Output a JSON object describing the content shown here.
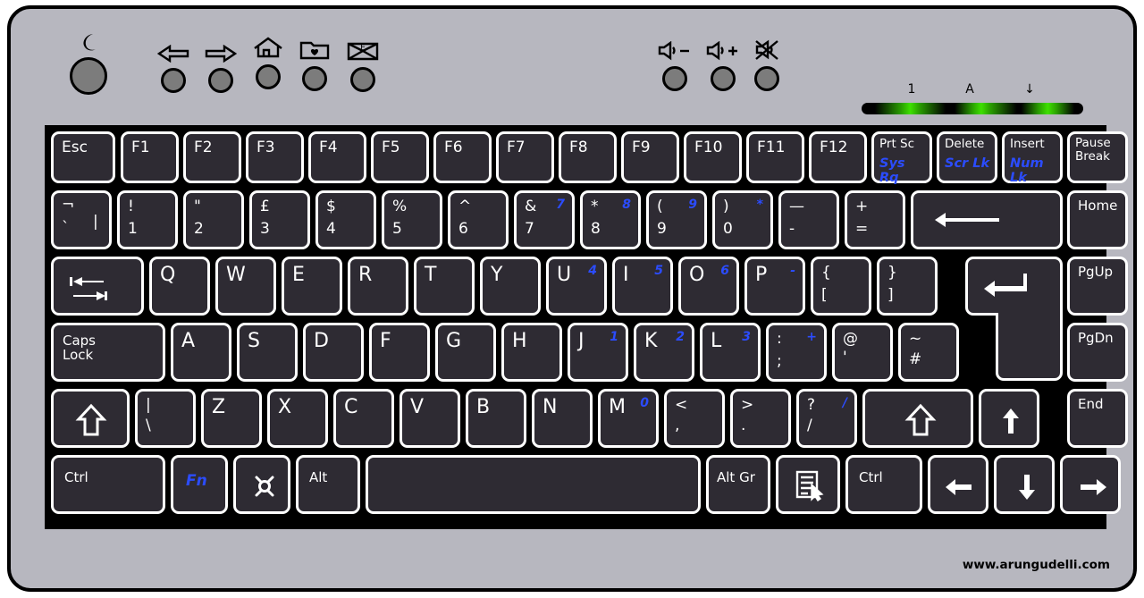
{
  "device": {
    "type": "laptop-keyboard-diagram",
    "layout": "UK English",
    "body_color": "#b7b7bf",
    "key_color": "#2e2b33",
    "legend_color": "#ffffff",
    "fn_legend_color": "#2b4cff",
    "led_color": "#3ee000"
  },
  "hotkeys": [
    {
      "name": "power-button",
      "icon": "moon-icon",
      "label": ""
    },
    {
      "name": "back-button",
      "icon": "arrow-left-icon",
      "label": ""
    },
    {
      "name": "forward-button",
      "icon": "arrow-right-icon",
      "label": ""
    },
    {
      "name": "home-button",
      "icon": "house-icon",
      "label": ""
    },
    {
      "name": "favorites-button",
      "icon": "folder-heart-icon",
      "label": ""
    },
    {
      "name": "email-button",
      "icon": "envelope-icon",
      "label": ""
    },
    {
      "name": "volume-down-button",
      "icon": "speaker-minus-icon",
      "label": ""
    },
    {
      "name": "volume-up-button",
      "icon": "speaker-plus-icon",
      "label": ""
    },
    {
      "name": "mute-button",
      "icon": "speaker-mute-icon",
      "label": ""
    }
  ],
  "leds": [
    {
      "name": "num-lock-led",
      "label": "1"
    },
    {
      "name": "caps-lock-led",
      "label": "A"
    },
    {
      "name": "scroll-lock-led",
      "label": "↓"
    }
  ],
  "rows": {
    "function_row": [
      {
        "name": "key-esc",
        "main": "Esc"
      },
      {
        "name": "key-f1",
        "main": "F1"
      },
      {
        "name": "key-f2",
        "main": "F2"
      },
      {
        "name": "key-f3",
        "main": "F3"
      },
      {
        "name": "key-f4",
        "main": "F4"
      },
      {
        "name": "key-f5",
        "main": "F5"
      },
      {
        "name": "key-f6",
        "main": "F6"
      },
      {
        "name": "key-f7",
        "main": "F7"
      },
      {
        "name": "key-f8",
        "main": "F8"
      },
      {
        "name": "key-f9",
        "main": "F9"
      },
      {
        "name": "key-f10",
        "main": "F10"
      },
      {
        "name": "key-f11",
        "main": "F11"
      },
      {
        "name": "key-f12",
        "main": "F12"
      },
      {
        "name": "key-print-screen",
        "main": "Prt Sc",
        "fn": "Sys Rq"
      },
      {
        "name": "key-delete",
        "main": "Delete",
        "fn": "Scr Lk"
      },
      {
        "name": "key-insert",
        "main": "Insert",
        "fn": "Num Lk"
      },
      {
        "name": "key-pause-break",
        "main": "Pause\nBreak"
      }
    ],
    "number_row": [
      {
        "name": "key-backtick",
        "shift": "¬",
        "base": "`",
        "extra": "|"
      },
      {
        "name": "key-1",
        "shift": "!",
        "base": "1"
      },
      {
        "name": "key-2",
        "shift": "\"",
        "base": "2"
      },
      {
        "name": "key-3",
        "shift": "£",
        "base": "3"
      },
      {
        "name": "key-4",
        "shift": "$",
        "base": "4"
      },
      {
        "name": "key-5",
        "shift": "%",
        "base": "5"
      },
      {
        "name": "key-6",
        "shift": "^",
        "base": "6"
      },
      {
        "name": "key-7",
        "shift": "&",
        "base": "7",
        "num": "7"
      },
      {
        "name": "key-8",
        "shift": "*",
        "base": "8",
        "num": "8"
      },
      {
        "name": "key-9",
        "shift": "(",
        "base": "9",
        "num": "9"
      },
      {
        "name": "key-0",
        "shift": ")",
        "base": "0",
        "num": "*"
      },
      {
        "name": "key-minus",
        "shift": "—",
        "base": "-"
      },
      {
        "name": "key-equals",
        "shift": "+",
        "base": "="
      },
      {
        "name": "key-backspace",
        "icon": "arrow-left-long-icon"
      },
      {
        "name": "key-home",
        "main": "Home"
      }
    ],
    "top_letter_row": [
      {
        "name": "key-tab",
        "icon": "tab-arrows-icon"
      },
      {
        "name": "key-q",
        "main": "Q"
      },
      {
        "name": "key-w",
        "main": "W"
      },
      {
        "name": "key-e",
        "main": "E"
      },
      {
        "name": "key-r",
        "main": "R"
      },
      {
        "name": "key-t",
        "main": "T"
      },
      {
        "name": "key-y",
        "main": "Y"
      },
      {
        "name": "key-u",
        "main": "U",
        "num": "4"
      },
      {
        "name": "key-i",
        "main": "I",
        "num": "5"
      },
      {
        "name": "key-o",
        "main": "O",
        "num": "6"
      },
      {
        "name": "key-p",
        "main": "P",
        "num": "-"
      },
      {
        "name": "key-bracket-left",
        "shift": "{",
        "base": "["
      },
      {
        "name": "key-bracket-right",
        "shift": "}",
        "base": "]"
      },
      {
        "name": "key-enter",
        "icon": "enter-arrow-icon"
      },
      {
        "name": "key-page-up",
        "main": "PgUp"
      }
    ],
    "home_row": [
      {
        "name": "key-caps-lock",
        "main": "Caps\nLock"
      },
      {
        "name": "key-a",
        "main": "A"
      },
      {
        "name": "key-s",
        "main": "S"
      },
      {
        "name": "key-d",
        "main": "D"
      },
      {
        "name": "key-f",
        "main": "F"
      },
      {
        "name": "key-g",
        "main": "G"
      },
      {
        "name": "key-h",
        "main": "H"
      },
      {
        "name": "key-j",
        "main": "J",
        "num": "1"
      },
      {
        "name": "key-k",
        "main": "K",
        "num": "2"
      },
      {
        "name": "key-l",
        "main": "L",
        "num": "3"
      },
      {
        "name": "key-semicolon",
        "shift": ":",
        "base": ";",
        "num": "+"
      },
      {
        "name": "key-apostrophe",
        "shift": "@",
        "base": "'"
      },
      {
        "name": "key-hash",
        "shift": "~",
        "base": "#"
      },
      {
        "name": "key-page-down",
        "main": "PgDn"
      }
    ],
    "bottom_letter_row": [
      {
        "name": "key-shift-left",
        "icon": "shift-arrow-icon"
      },
      {
        "name": "key-backslash",
        "shift": "|",
        "base": "\\"
      },
      {
        "name": "key-z",
        "main": "Z"
      },
      {
        "name": "key-x",
        "main": "X"
      },
      {
        "name": "key-c",
        "main": "C"
      },
      {
        "name": "key-v",
        "main": "V"
      },
      {
        "name": "key-b",
        "main": "B"
      },
      {
        "name": "key-n",
        "main": "N"
      },
      {
        "name": "key-m",
        "main": "M",
        "num": "0"
      },
      {
        "name": "key-comma",
        "shift": "<",
        "base": ","
      },
      {
        "name": "key-period",
        "shift": ">",
        "base": "."
      },
      {
        "name": "key-slash",
        "shift": "?",
        "base": "/",
        "num": "/"
      },
      {
        "name": "key-shift-right",
        "icon": "shift-arrow-icon"
      },
      {
        "name": "key-arrow-up",
        "icon": "arrow-up-icon"
      },
      {
        "name": "key-end",
        "main": "End"
      }
    ],
    "modifier_row": [
      {
        "name": "key-ctrl-left",
        "main": "Ctrl"
      },
      {
        "name": "key-fn",
        "fnonly": "Fn"
      },
      {
        "name": "key-super",
        "icon": "os-logo-icon"
      },
      {
        "name": "key-alt-left",
        "main": "Alt"
      },
      {
        "name": "key-space",
        "main": ""
      },
      {
        "name": "key-alt-gr",
        "main": "Alt Gr"
      },
      {
        "name": "key-menu",
        "icon": "context-menu-icon"
      },
      {
        "name": "key-ctrl-right",
        "main": "Ctrl"
      },
      {
        "name": "key-arrow-left",
        "icon": "arrow-left-icon"
      },
      {
        "name": "key-arrow-down",
        "icon": "arrow-down-icon"
      },
      {
        "name": "key-arrow-right",
        "icon": "arrow-right-icon"
      }
    ]
  },
  "watermark": {
    "text": "www.arungudelli.com"
  }
}
